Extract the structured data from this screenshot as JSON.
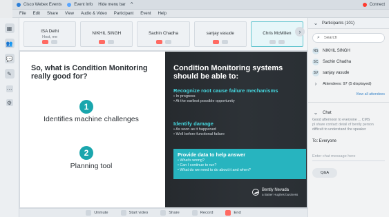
{
  "window": {
    "titlebar_items": [
      "Cisco Webex Events",
      "Event Info",
      "Hide menu bar"
    ],
    "titlebar_right": "Connect"
  },
  "menubar": [
    "File",
    "Edit",
    "Share",
    "View",
    "Audio & Video",
    "Participant",
    "Event",
    "Help"
  ],
  "participants_strip": [
    {
      "name": "ISA Delhi",
      "sub": "Host, me"
    },
    {
      "name": "NIKHIL SINGH",
      "sub": ""
    },
    {
      "name": "Sachin Chadha",
      "sub": ""
    },
    {
      "name": "sanjay vasude",
      "sub": ""
    },
    {
      "name": "Chris McMillen",
      "sub": ""
    }
  ],
  "slide": {
    "left": {
      "title": "So, what is Condition Monitoring really good for?",
      "item1_number": "1",
      "item1_text": "Identifies machine challenges",
      "item2_number": "2",
      "item2_text": "Planning tool"
    },
    "right": {
      "title": "Condition Monitoring systems should be able to:",
      "section1_header": "Recognize root cause failure mechanisms",
      "section1_bullets": [
        "• In progress",
        "• At the earliest possible opportunity"
      ],
      "section2_header": "Identify damage",
      "section2_bullets": [
        "• As soon as it happened",
        "• Well before functional failure"
      ],
      "callout_header": "Provide data to help answer",
      "callout_bullets": [
        "• What's wrong?",
        "• Can I continue to run?",
        "• What do we need to do about it and when?"
      ],
      "logo_text": "Bently Nevada",
      "logo_subtext": "a Baker Hughes business"
    }
  },
  "right_panel": {
    "participants_header": "Participants (101)",
    "search_placeholder": "Search",
    "participants": [
      {
        "initials": "NS",
        "name": "NIKHIL SINGH"
      },
      {
        "initials": "SC",
        "name": "Sachin Chadha"
      },
      {
        "initials": "SV",
        "name": "sanjay vasude"
      }
    ],
    "attendees": "Attendees: 97 (5 displayed)",
    "view_all": "View all attendees",
    "chat_header": "Chat",
    "chat_message_1": "Good afternoon to everyone ... CMS",
    "chat_message_2": "pl share contact detail of bently person",
    "chat_message_3": "difficult to understand the speaker",
    "chat_to": "To: Everyone",
    "chat_placeholder": "Enter chat message here",
    "chat_button": "Q&A"
  },
  "bottom_toolbar": [
    "Unmute",
    "Start video",
    "Share",
    "Record",
    "End"
  ],
  "colors": {
    "teal": "#1aa6ad",
    "dark_slide": "#2a2f34",
    "accent_red": "#ff3b30"
  }
}
